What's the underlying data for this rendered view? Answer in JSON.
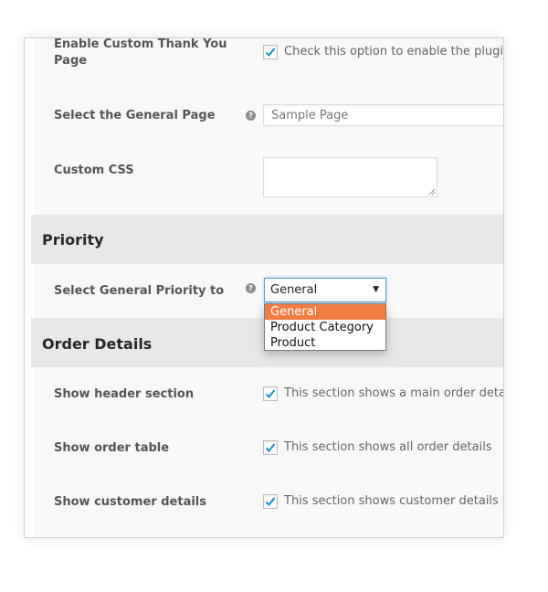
{
  "general": {
    "thank_you_label": "Enable Custom Thank You Page",
    "thank_you_desc": "Check this option to enable the plugin",
    "general_page_label": "Select the General Page",
    "general_page_value": "Sample Page",
    "custom_css_label": "Custom CSS"
  },
  "priority": {
    "title": "Priority",
    "select_label": "Select General Priority to",
    "selected": "General",
    "options": [
      "General",
      "Product Category",
      "Product"
    ]
  },
  "order_details": {
    "title": "Order Details",
    "rows": [
      {
        "label": "Show header section",
        "desc": "This section shows a main order detail"
      },
      {
        "label": "Show order table",
        "desc": "This section shows all order details"
      },
      {
        "label": "Show customer details",
        "desc": "This section shows customer details"
      }
    ]
  },
  "icons": {
    "help": "question-circle-icon",
    "check": "checkmark-icon",
    "arrow": "dropdown-arrow-icon"
  },
  "colors": {
    "highlight": "#f07c44",
    "check": "#1e8cbe",
    "focus_border": "#5b9dd9"
  }
}
